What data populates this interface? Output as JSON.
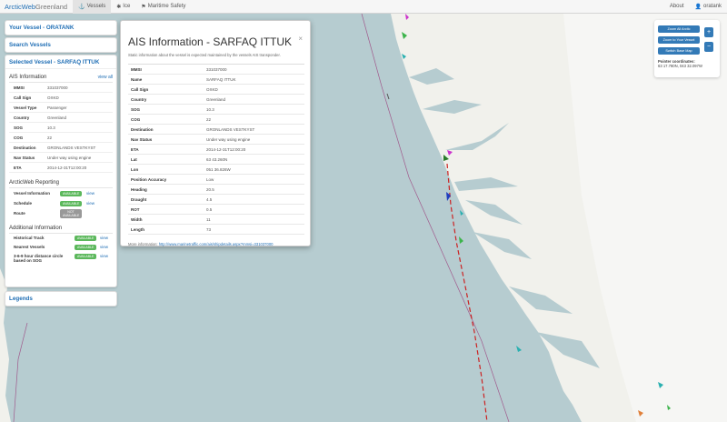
{
  "navbar": {
    "brand_part1": "ArcticWeb",
    "brand_part2": "Greenland",
    "items": [
      {
        "label": "Vessels"
      },
      {
        "label": "Ice"
      },
      {
        "label": "Maritime Safety"
      }
    ],
    "about_label": "About",
    "user_label": "oratank"
  },
  "panels": {
    "your_vessel": "Your Vessel - ORATANK",
    "search_vessels": "Search Vessels",
    "selected_vessel": "Selected Vessel - SARFAQ ITTUK",
    "legends": "Legends"
  },
  "ais_section": {
    "title": "AIS Information",
    "view_all": "view all",
    "rows": [
      {
        "k": "MMSI",
        "v": "331037000"
      },
      {
        "k": "Call Sign",
        "v": "OXKD"
      },
      {
        "k": "Vessel Type",
        "v": "Passenger"
      },
      {
        "k": "Country",
        "v": "Greenland"
      },
      {
        "k": "SOG",
        "v": "10.3"
      },
      {
        "k": "COG",
        "v": "22"
      },
      {
        "k": "Destination",
        "v": "GRONLANDS VESTKYST"
      },
      {
        "k": "Nav Status",
        "v": "Under way using engine"
      },
      {
        "k": "ETA",
        "v": "2014-12-31T12:00:20"
      }
    ]
  },
  "reporting": {
    "title": "ArcticWeb Reporting",
    "rows": [
      {
        "k": "Vessel Information",
        "badge": "AVAILABLE",
        "link": "view"
      },
      {
        "k": "Schedule",
        "badge": "AVAILABLE",
        "link": "view"
      },
      {
        "k": "Route",
        "badge": "NOT AVAILABLE",
        "link": ""
      }
    ]
  },
  "additional": {
    "title": "Additional Information",
    "rows": [
      {
        "k": "Historical Track",
        "badge": "AVAILABLE",
        "link": "view"
      },
      {
        "k": "Nearest Vessels",
        "badge": "AVAILABLE",
        "link": "view"
      },
      {
        "k": "3-6-9 hour distance circle based on SOG",
        "badge": "AVAILABLE",
        "link": "view"
      }
    ]
  },
  "dialog": {
    "title": "AIS Information - SARFAQ ITTUK",
    "close": "×",
    "description": "Static information about the vessel is expected maintained by the vessels AIS transponder.",
    "rows": [
      {
        "k": "MMSI",
        "v": "331037000"
      },
      {
        "k": "Name",
        "v": "SARFAQ ITTUK"
      },
      {
        "k": "Call Sign",
        "v": "OXKD"
      },
      {
        "k": "Country",
        "v": "Greenland"
      },
      {
        "k": "SOG",
        "v": "10.3"
      },
      {
        "k": "COG",
        "v": "22"
      },
      {
        "k": "Destination",
        "v": "GRONLANDS VESTKYST"
      },
      {
        "k": "Nav Status",
        "v": "Under way using engine"
      },
      {
        "k": "ETA",
        "v": "2014-12-31T12:00:20"
      },
      {
        "k": "Lat",
        "v": "63 43.260N"
      },
      {
        "k": "Lon",
        "v": "051 36.826W"
      },
      {
        "k": "Position Accuracy",
        "v": "Low"
      },
      {
        "k": "Heading",
        "v": "20.5"
      },
      {
        "k": "Draught",
        "v": "4.5"
      },
      {
        "k": "ROT",
        "v": "0.5"
      },
      {
        "k": "Width",
        "v": "11"
      },
      {
        "k": "Length",
        "v": "73"
      }
    ],
    "more_label": "More information:",
    "more_link": "http://www.marinetraffic.com/ais/shipdetails.aspx?mmsi=331037000"
  },
  "controls": {
    "zoom_arctic": "Zoom All Arctic",
    "zoom_vessel": "Zoom to Your Vessel",
    "switch_map": "Switch Base Map",
    "zoom_in": "+",
    "zoom_out": "−",
    "pointer_label": "Pointer coordinates:",
    "pointer_value": "63 17.780N, 043 32.097W"
  },
  "colors": {
    "brand": "#1f6eb5",
    "button": "#337ab7",
    "available": "#5cb85c",
    "not_available": "#999999",
    "sea": "#b6ccd0",
    "land": "#f1f1ec"
  }
}
